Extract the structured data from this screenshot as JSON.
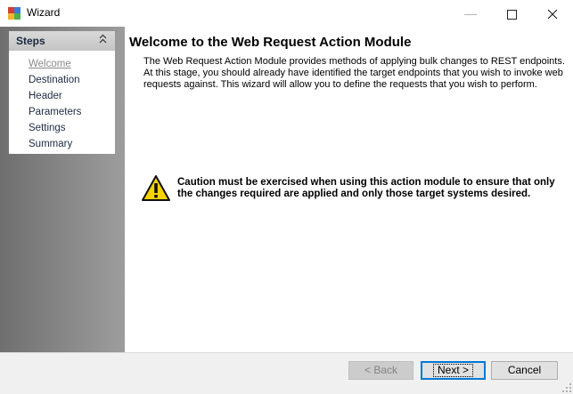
{
  "window": {
    "title": "Wizard"
  },
  "sidebar": {
    "title": "Steps",
    "steps": [
      {
        "label": "Welcome",
        "current": true
      },
      {
        "label": "Destination"
      },
      {
        "label": "Header"
      },
      {
        "label": "Parameters"
      },
      {
        "label": "Settings"
      },
      {
        "label": "Summary"
      }
    ]
  },
  "main": {
    "title": "Welcome to the Web Request Action Module",
    "description": "The Web Request Action Module provides methods of applying bulk changes to REST endpoints.  At this stage, you should already have identified the target endpoints that you wish to invoke web requests against.  This wizard will allow you to define the requests that you wish to perform.",
    "caution": "Caution must be exercised when using this action module to ensure that only the changes required are applied and only those target systems desired."
  },
  "buttons": {
    "back": "< Back",
    "next": "Next >",
    "cancel": "Cancel"
  },
  "colors": {
    "accent": "#0078d7",
    "warning": "#f5d300"
  }
}
